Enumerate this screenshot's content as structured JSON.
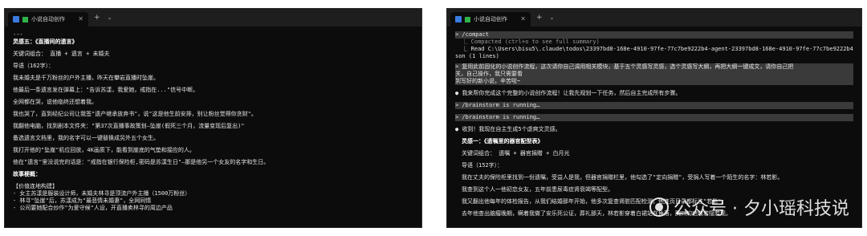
{
  "left_window": {
    "tab_title": "小说自动创作",
    "controls": {
      "new_tab": "+",
      "dropdown": "⌄",
      "close": "✕"
    },
    "lines": [
      "---",
      "灵感五：《直播间的遗言》",
      "关键词组合： 直播 + 遗言 + 未婚夫",
      "导语（162字）：",
      "我未婚夫是千万粉丝的户外主播，昨天在攀岩直播时坠崖。",
      "他最后一条遗言发在弹幕上：\"告诉苏漾，我爱她，戒指在...\"信号中断。",
      "全网都在哭，说他临终还想着我。",
      "我也哭了，直到经纪公司让我签\"遗产继承放弃书\"，说\"这是他生前安排，别让粉丝觉得你贪财\"。",
      "我翻他电脑，找到剧本文件夹：\"第37次直播事故策划—坠崖(假死三个月，流量变现后复出)\"",
      "备选遗言文档里，我的名字可以一键替换成另外五个女生。",
      "我打开他的\"坠崖\"机位回放，4K画质下，能看到崖底的气垫和接应的人。",
      "他在\"遗言\"里没说完的话是：\"戒指在银行保险柜,密码是苏漾生日\"—那是他另一个女友的名字和生日。",
      "故事梗概：",
      "【价值连地构建】",
      "- 女主苏漾是服装设计师，未婚夫林寻是顶流户外主播（1500万粉丝）",
      "- 林寻\"坠崖\"后，苏漾成为\"最悲情未婚妻\"，全网同情",
      "- 公司要她配合炒作\"为爱守候\"人设，开直播卖林寻的周边产品"
    ]
  },
  "right_window": {
    "tab_title": "小说自动创作",
    "controls": {
      "new_tab": "+",
      "dropdown": "⌄",
      "close": "✕"
    },
    "compact_cmd": "> /compact",
    "compact_info_1": "  ⎿ Compacted (ctrl+o to see full summary)",
    "compact_info_2": "  ⎿ Read C:\\Users\\bisu5\\.claude\\todos\\23397bd8-168e-4910-97fe-77c7be9222b4-agent-23397bd8-168e-4910-97fe-77c7be9222b4.j",
    "compact_info_3": "son (1 lines)",
    "user_prompt_1": "> 复用此前固化的小说创作流程，这次请你自己调用相关模块，基于五个灵感写灵感，选个灵感写大纲，再把大纲一键成文，请你自己把",
    "user_prompt_2": "关，自己操作，我只需要看",
    "user_prompt_3": "到写好的新小说，辛苦啦~",
    "reply_1": "我来帮你完成这个完整的小说创作流程！让我先规划一下任务，然后自主完成所有步骤。",
    "brainstorm_1": "> /brainstorm is running…",
    "brainstorm_2": "> /brainstorm is running…",
    "reply_2": "收到！我现在自主生成5个虐爽文灵感。",
    "inspiration_title": "灵感一：《遗嘱里的器官配型表》",
    "keywords": "关键词组合： 遗嘱 + 器官捐赠 + 白月光",
    "intro_label": "导语（152字）：",
    "story_lines": [
      "我在丈夫的保险柜里找到一份遗嘱，受益人是我，但器官捐赠栏里，他勾选了\"定向捐赠\"，受捐人写着一个陌生的名字：林若影。",
      "我查到这个人一他初恋女友，五年前患尿毒症肾衰竭等配型。",
      "我又翻出他每年的体检报告，从我们结婚那年开始，他多次复查肾脏匹配检测，他连页目录都标注\"若影\"。",
      "去年他查出脑瘤晚期，瞒着我做了安乐死公证，葬礼那天，林若影穿着白裙站在角落，胸口的疤痕若隐若现。"
    ]
  },
  "watermark": {
    "text": "公众号 · 夕小瑶科技说"
  }
}
